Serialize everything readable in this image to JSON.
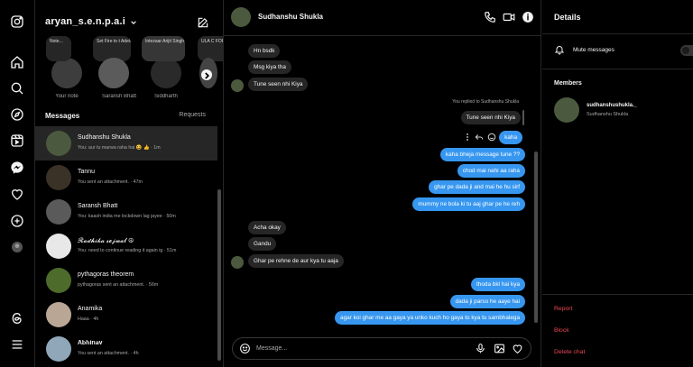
{
  "profile": {
    "username": "aryan_s.e.n.p.a.i"
  },
  "notes": [
    {
      "text": "Note...",
      "label": "Your note"
    },
    {
      "text": "Set Fire to t Adele",
      "label": ""
    },
    {
      "text": "",
      "label": "Saransh Bhatt"
    },
    {
      "text": "Intezaar Arijit Singh",
      "label": "Siddharth"
    },
    {
      "text": "ULA C FOR H",
      "label": ""
    }
  ],
  "tabs": {
    "messages": "Messages",
    "requests": "Requests"
  },
  "conversations": [
    {
      "name": "Sudhanshu Shukla",
      "preview": "You: aur tu marwa raha hai 😆 👍 · 1m",
      "active": true
    },
    {
      "name": "Tannu",
      "preview": "You sent an attachment. · 47m",
      "active": false
    },
    {
      "name": "Saransh Bhatt",
      "preview": "You: kaash india me lockdown lag jayee · 50m",
      "active": false
    },
    {
      "name": "𝓡𝓪𝓭𝓱𝓲𝓴𝓪 𝓼𝓮𝓳𝔀𝓪𝓵 ☮︎",
      "preview": "You: need to continue reading it again ig · 51m",
      "active": false
    },
    {
      "name": "pythagoras theorem",
      "preview": "pythagoras sent an attachment. · 56m",
      "active": false
    },
    {
      "name": "Anamika",
      "preview": "Haaa · 4h",
      "active": false
    },
    {
      "name": "𝐀𝐛𝐡𝐢𝐧𝐚𝐯",
      "preview": "You sent an attachment. · 4h",
      "active": false
    }
  ],
  "chat": {
    "name": "Sudhanshu Shukla",
    "reply_note": "You replied to Sudhanshu Shukla",
    "reply_quote": "Tune seen nhi Kiya",
    "incoming_1": [
      "Hn bsdk",
      "Msg kiya tha",
      "Tune seen nhi Kiya"
    ],
    "outgoing_1": [
      "kaha",
      "kaha bheja message tune ??",
      "chod mai nahi aa raha",
      "ghar pe dada ji and mai he hu sirf",
      "mummy ne bola ki tu aaj ghar pe he reh"
    ],
    "incoming_2": [
      "Acha okay",
      "Gandu",
      "Ghar pe rehne de aur kya tu aaja"
    ],
    "outgoing_2": [
      "thoda bkl hai kya",
      "dada ji parso he aaye hai",
      "agar koi ghar me aa gaya ya unko kuch ho gaya to kya tu sambhalega"
    ],
    "composer_placeholder": "Message..."
  },
  "details": {
    "title": "Details",
    "mute_label": "Mute messages",
    "mute_on": false,
    "members_title": "Members",
    "member": {
      "username": "sudhanshushukla._",
      "name": "Sudhanshu Shukla"
    },
    "report": "Report",
    "block": "Block",
    "delete": "Delete chat"
  },
  "colors": {
    "accent": "#3797f0",
    "danger": "#ed4956",
    "bubble_in": "#262626"
  }
}
